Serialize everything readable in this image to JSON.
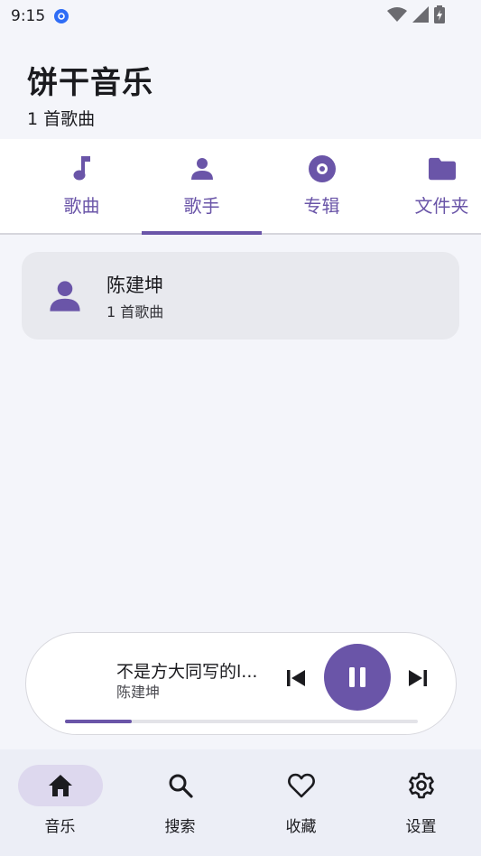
{
  "status_bar": {
    "time": "9:15",
    "icons": [
      "app-notification-icon",
      "wifi-icon",
      "cellular-signal-icon",
      "battery-charging-icon"
    ]
  },
  "header": {
    "title": "饼干音乐",
    "subtitle": "1 首歌曲"
  },
  "tabs": [
    {
      "label": "歌曲",
      "icon": "music-note-icon",
      "selected": false
    },
    {
      "label": "歌手",
      "icon": "person-icon",
      "selected": true
    },
    {
      "label": "专辑",
      "icon": "album-disc-icon",
      "selected": false
    },
    {
      "label": "文件夹",
      "icon": "folder-icon",
      "selected": false
    }
  ],
  "artists": [
    {
      "name": "陈建坤",
      "songs": "1 首歌曲",
      "icon": "person-icon"
    }
  ],
  "player": {
    "title": "不是方大同写的l...",
    "artist": "陈建坤",
    "state": "playing",
    "progress": 0.19
  },
  "bottom_nav": [
    {
      "label": "音乐",
      "icon": "home-icon",
      "active": true
    },
    {
      "label": "搜索",
      "icon": "search-icon",
      "active": false
    },
    {
      "label": "收藏",
      "icon": "heart-icon",
      "active": false
    },
    {
      "label": "设置",
      "icon": "gear-icon",
      "active": false
    }
  ],
  "colors": {
    "accent": "#6a55a8",
    "background": "#f4f5fa",
    "card": "#e8e9ee",
    "nav_active_pill": "#ddd8ee"
  }
}
